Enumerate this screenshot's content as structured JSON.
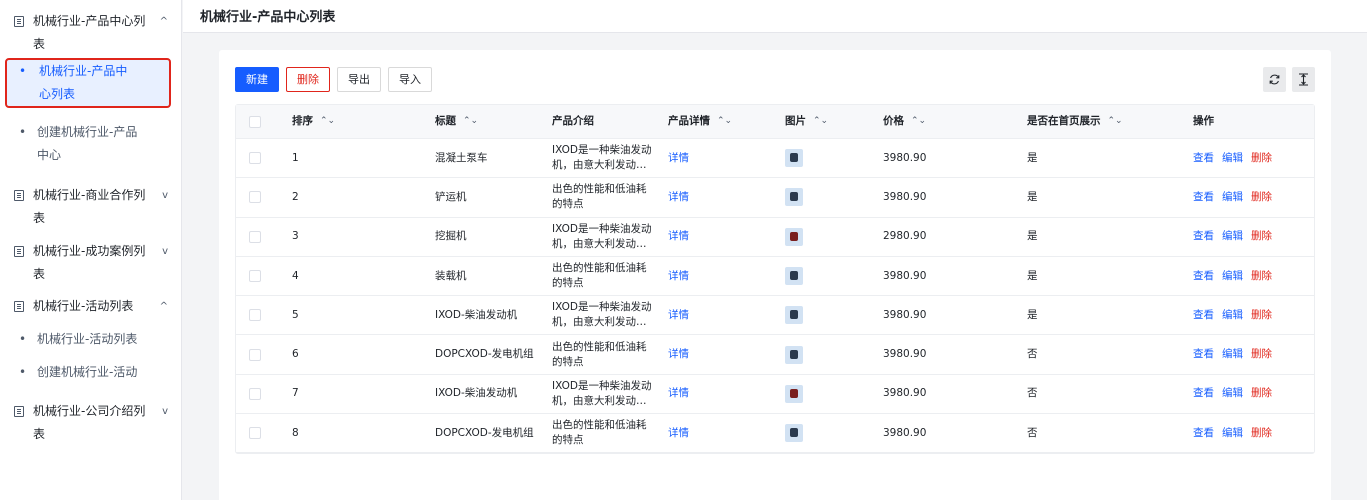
{
  "header": {
    "title": "机械行业-产品中心列表"
  },
  "sidebar": {
    "groups": [
      {
        "label": "机械行业-产品中心列表",
        "chevron": "^"
      },
      {
        "label": "机械行业-商业合作列表",
        "chevron": "v"
      },
      {
        "label": "机械行业-成功案例列表",
        "chevron": "v"
      },
      {
        "label": "机械行业-活动列表",
        "chevron": "^"
      },
      {
        "label": "机械行业-公司介绍列表",
        "chevron": "v"
      }
    ],
    "sub_items": [
      {
        "label": "机械行业-产品中心列表"
      },
      {
        "label": "创建机械行业-产品中心"
      },
      {
        "label": "机械行业-活动列表"
      },
      {
        "label": "创建机械行业-活动"
      }
    ]
  },
  "toolbar": {
    "new": "新建",
    "delete": "删除",
    "export": "导出",
    "import": "导入"
  },
  "table": {
    "columns": [
      "排序",
      "标题",
      "产品介绍",
      "产品详情",
      "图片",
      "价格",
      "是否在首页展示",
      "操作"
    ],
    "ops": {
      "view": "查看",
      "edit": "编辑",
      "delete": "删除"
    },
    "rows": [
      {
        "order": "1",
        "title": "混凝土泵车",
        "intro": "IXOD是一种柴油发动机，由意大利发动机制造",
        "detail": "详情",
        "price": "3980.90",
        "show": "是"
      },
      {
        "order": "2",
        "title": "铲运机",
        "intro": "出色的性能和低油耗的特点",
        "detail": "详情",
        "price": "3980.90",
        "show": "是"
      },
      {
        "order": "3",
        "title": "挖掘机",
        "intro": "IXOD是一种柴油发动机，由意大利发动机制造",
        "detail": "详情",
        "price": "2980.90",
        "show": "是"
      },
      {
        "order": "4",
        "title": "装载机",
        "intro": "出色的性能和低油耗的特点",
        "detail": "详情",
        "price": "3980.90",
        "show": "是"
      },
      {
        "order": "5",
        "title": "IXOD-柴油发动机",
        "intro": "IXOD是一种柴油发动机，由意大利发动机制造",
        "detail": "详情",
        "price": "3980.90",
        "show": "是"
      },
      {
        "order": "6",
        "title": "DOPCXOD-发电机组",
        "intro": "出色的性能和低油耗的特点",
        "detail": "详情",
        "price": "3980.90",
        "show": "否"
      },
      {
        "order": "7",
        "title": "IXOD-柴油发动机",
        "intro": "IXOD是一种柴油发动机，由意大利发动机制造",
        "detail": "详情",
        "price": "3980.90",
        "show": "否"
      },
      {
        "order": "8",
        "title": "DOPCXOD-发电机组",
        "intro": "出色的性能和低油耗的特点",
        "detail": "详情",
        "price": "3980.90",
        "show": "否"
      }
    ]
  }
}
